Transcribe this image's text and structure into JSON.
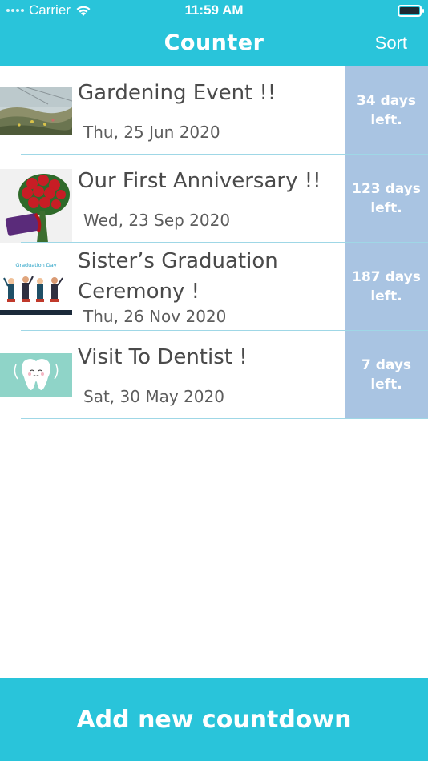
{
  "status_bar": {
    "carrier": "Carrier",
    "time": "11:59 AM",
    "icons": [
      "signal-dots-icon",
      "wifi-icon",
      "battery-icon"
    ]
  },
  "nav": {
    "title": "Counter",
    "sort_label": "Sort"
  },
  "countdowns": [
    {
      "title": "Gardening Event !!",
      "date": "Thu, 25 Jun 2020",
      "days_left": "34 days left.",
      "thumbnail": "grassy-dunes-photo"
    },
    {
      "title": "Our First Anniversary !!",
      "date": "Wed, 23 Sep 2020",
      "days_left": "123 days left.",
      "thumbnail": "red-roses-bouquet-photo"
    },
    {
      "title": "Sister’s Graduation Ceremony !",
      "date": "Thu, 26 Nov 2020",
      "days_left": "187 days left.",
      "thumbnail": "graduation-day-illustration",
      "thumbnail_caption": "Graduation Day"
    },
    {
      "title": "Visit To Dentist !",
      "date": "Sat, 30 May 2020",
      "days_left": "7 days left.",
      "thumbnail": "cartoon-tooth-illustration"
    }
  ],
  "add_button": {
    "label": "Add new countdown"
  },
  "colors": {
    "accent": "#29c4da",
    "days_panel": "#a9c4e2",
    "divider": "#9fd7e6",
    "title_text": "#4a4a4a"
  }
}
